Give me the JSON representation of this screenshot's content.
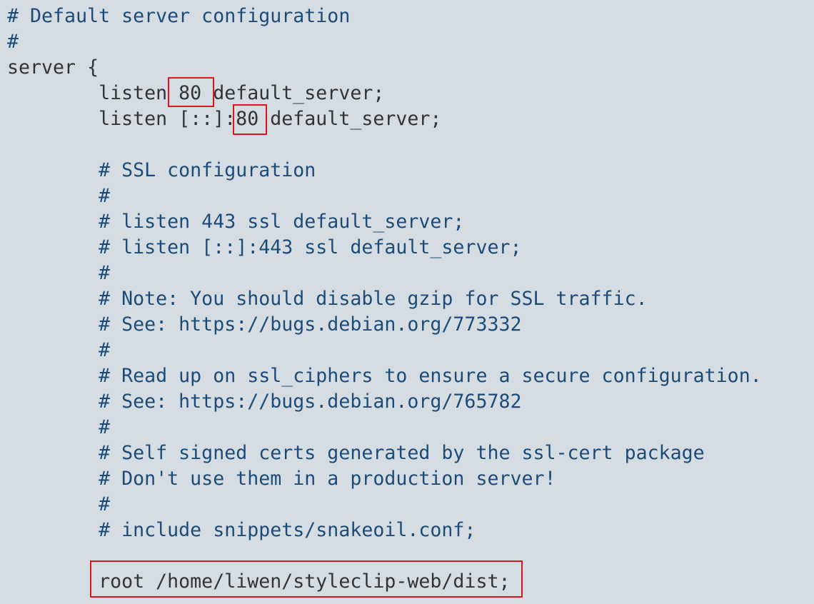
{
  "code": {
    "line_01": "# Default server configuration",
    "line_02": "#",
    "line_03": "server {",
    "line_04": "        listen 80 default_server;",
    "line_05": "        listen [::]:80 default_server;",
    "line_06": "",
    "line_07": "        # SSL configuration",
    "line_08": "        #",
    "line_09": "        # listen 443 ssl default_server;",
    "line_10": "        # listen [::]:443 ssl default_server;",
    "line_11": "        #",
    "line_12": "        # Note: You should disable gzip for SSL traffic.",
    "line_13": "        # See: https://bugs.debian.org/773332",
    "line_14": "        #",
    "line_15": "        # Read up on ssl_ciphers to ensure a secure configuration.",
    "line_16": "        # See: https://bugs.debian.org/765782",
    "line_17": "        #",
    "line_18": "        # Self signed certs generated by the ssl-cert package",
    "line_19": "        # Don't use them in a production server!",
    "line_20": "        #",
    "line_21": "        # include snippets/snakeoil.conf;",
    "line_22": "",
    "line_23": "        root /home/liwen/styleclip-web/dist;"
  },
  "colors": {
    "background": "#d5dde2",
    "comment_text": "#1c4b78",
    "plain_text": "#333333",
    "highlight_border": "#e0141e"
  }
}
